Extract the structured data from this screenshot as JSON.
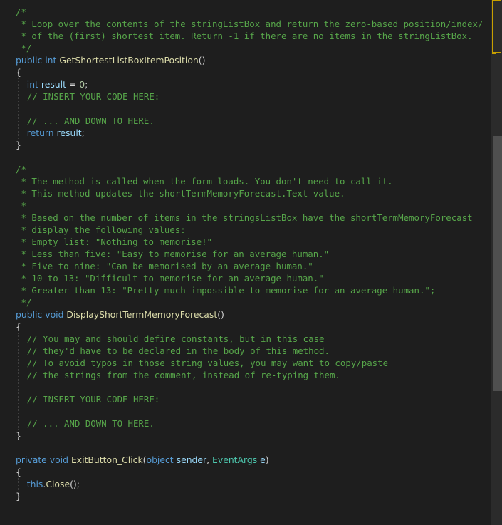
{
  "editor": {
    "lines": [
      [
        {
          "t": "/*",
          "c": "com"
        }
      ],
      [
        {
          "t": " * Loop over the contents of the stringListBox and return the zero-based position/index/",
          "c": "com"
        }
      ],
      [
        {
          "t": " * of the (first) shortest item. Return -1 if there are no items in the stringListBox.",
          "c": "com"
        }
      ],
      [
        {
          "t": " */",
          "c": "com"
        }
      ],
      [
        {
          "t": "public",
          "c": "kw"
        },
        {
          "t": " ",
          "c": "plain"
        },
        {
          "t": "int",
          "c": "kw"
        },
        {
          "t": " ",
          "c": "plain"
        },
        {
          "t": "GetShortestListBoxItemPosition",
          "c": "fn"
        },
        {
          "t": "()",
          "c": "plain"
        }
      ],
      [
        {
          "t": "{",
          "c": "plain"
        }
      ],
      [
        {
          "t": "    ",
          "c": "plain"
        },
        {
          "t": "int",
          "c": "kw"
        },
        {
          "t": " ",
          "c": "plain"
        },
        {
          "t": "result",
          "c": "var"
        },
        {
          "t": " = ",
          "c": "plain"
        },
        {
          "t": "0",
          "c": "num"
        },
        {
          "t": ";",
          "c": "plain"
        }
      ],
      [
        {
          "t": "    ",
          "c": "plain"
        },
        {
          "t": "// INSERT YOUR CODE HERE:",
          "c": "com"
        }
      ],
      [],
      [
        {
          "t": "    ",
          "c": "plain"
        },
        {
          "t": "// ... AND DOWN TO HERE.",
          "c": "com"
        }
      ],
      [
        {
          "t": "    ",
          "c": "plain"
        },
        {
          "t": "return",
          "c": "kw"
        },
        {
          "t": " ",
          "c": "plain"
        },
        {
          "t": "result",
          "c": "var"
        },
        {
          "t": ";",
          "c": "plain"
        }
      ],
      [
        {
          "t": "}",
          "c": "plain"
        }
      ],
      [],
      [
        {
          "t": "/*",
          "c": "com"
        }
      ],
      [
        {
          "t": " * The method is called when the form loads. You don't need to call it.",
          "c": "com"
        }
      ],
      [
        {
          "t": " * This method updates the shortTermMemoryForecast.Text value.",
          "c": "com"
        }
      ],
      [
        {
          "t": " *",
          "c": "com"
        }
      ],
      [
        {
          "t": " * Based on the number of items in the stringsListBox have the shortTermMemoryForecast",
          "c": "com"
        }
      ],
      [
        {
          "t": " * display the following values:",
          "c": "com"
        }
      ],
      [
        {
          "t": " * Empty list: \"Nothing to memorise!\"",
          "c": "com"
        }
      ],
      [
        {
          "t": " * Less than five: \"Easy to memorise for an average human.\"",
          "c": "com"
        }
      ],
      [
        {
          "t": " * Five to nine: \"Can be memorised by an average human.\"",
          "c": "com"
        }
      ],
      [
        {
          "t": " * 10 to 13: \"Difficult to memorise for an average human.\"",
          "c": "com"
        }
      ],
      [
        {
          "t": " * Greater than 13: \"Pretty much impossible to memorise for an average human.\";",
          "c": "com"
        }
      ],
      [
        {
          "t": " */",
          "c": "com"
        }
      ],
      [
        {
          "t": "public",
          "c": "kw"
        },
        {
          "t": " ",
          "c": "plain"
        },
        {
          "t": "void",
          "c": "kw"
        },
        {
          "t": " ",
          "c": "plain"
        },
        {
          "t": "DisplayShortTermMemoryForecast",
          "c": "fn"
        },
        {
          "t": "()",
          "c": "plain"
        }
      ],
      [
        {
          "t": "{",
          "c": "plain"
        }
      ],
      [
        {
          "t": "    ",
          "c": "plain"
        },
        {
          "t": "// You may and should define constants, but in this case",
          "c": "com"
        }
      ],
      [
        {
          "t": "    ",
          "c": "plain"
        },
        {
          "t": "// they'd have to be declared in the body of this method.",
          "c": "com"
        }
      ],
      [
        {
          "t": "    ",
          "c": "plain"
        },
        {
          "t": "// To avoid typos in those string values, you may want to copy/paste",
          "c": "com"
        }
      ],
      [
        {
          "t": "    ",
          "c": "plain"
        },
        {
          "t": "// the strings from the comment, instead of re-typing them.",
          "c": "com"
        }
      ],
      [],
      [
        {
          "t": "    ",
          "c": "plain"
        },
        {
          "t": "// INSERT YOUR CODE HERE:",
          "c": "com"
        }
      ],
      [],
      [
        {
          "t": "    ",
          "c": "plain"
        },
        {
          "t": "// ... AND DOWN TO HERE.",
          "c": "com"
        }
      ],
      [
        {
          "t": "}",
          "c": "plain"
        }
      ],
      [],
      [
        {
          "t": "private",
          "c": "kw"
        },
        {
          "t": " ",
          "c": "plain"
        },
        {
          "t": "void",
          "c": "kw"
        },
        {
          "t": " ",
          "c": "plain"
        },
        {
          "t": "ExitButton_Click",
          "c": "fn"
        },
        {
          "t": "(",
          "c": "plain"
        },
        {
          "t": "object",
          "c": "kw"
        },
        {
          "t": " ",
          "c": "plain"
        },
        {
          "t": "sender",
          "c": "var"
        },
        {
          "t": ", ",
          "c": "plain"
        },
        {
          "t": "EventArgs",
          "c": "cls"
        },
        {
          "t": " ",
          "c": "plain"
        },
        {
          "t": "e",
          "c": "var"
        },
        {
          "t": ")",
          "c": "plain"
        }
      ],
      [
        {
          "t": "{",
          "c": "plain"
        }
      ],
      [
        {
          "t": "    ",
          "c": "plain"
        },
        {
          "t": "this",
          "c": "kw"
        },
        {
          "t": ".",
          "c": "plain"
        },
        {
          "t": "Close",
          "c": "fn"
        },
        {
          "t": "();",
          "c": "plain"
        }
      ],
      [
        {
          "t": "}",
          "c": "plain"
        }
      ]
    ]
  },
  "colors": {
    "background": "#1e1e1e",
    "comment": "#57a64a",
    "keyword": "#569cd6",
    "method": "#dcdcaa",
    "variable": "#9cdcfe",
    "type": "#4ec9b0",
    "number": "#b5cea8",
    "text": "#d4d4d4"
  }
}
